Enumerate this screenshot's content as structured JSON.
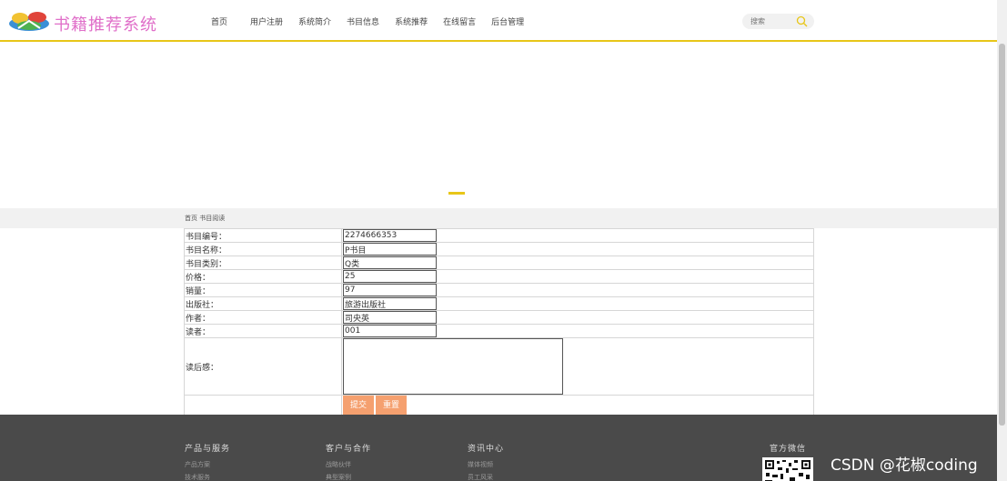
{
  "header": {
    "brand": "书籍推荐系统",
    "nav": [
      "首页",
      "用户注册",
      "系统简介",
      "书目信息",
      "系统推荐",
      "在线留言",
      "后台管理"
    ],
    "search_placeholder": "搜索"
  },
  "breadcrumb": "首页 书目阅读",
  "form": {
    "rows": [
      {
        "label": "书目编号：",
        "value": "2274666353"
      },
      {
        "label": "书目名称：",
        "value": "P书目"
      },
      {
        "label": "书目类别：",
        "value": "Q类"
      },
      {
        "label": "价格：",
        "value": "25"
      },
      {
        "label": "销量：",
        "value": "97"
      },
      {
        "label": "出版社：",
        "value": "旅游出版社"
      },
      {
        "label": "作者：",
        "value": "司央英"
      },
      {
        "label": "读者：",
        "value": "001"
      }
    ],
    "review_label": "读后感：",
    "review_value": "",
    "submit_label": "提交",
    "reset_label": "重置"
  },
  "footer": {
    "col1": {
      "title": "产品与服务",
      "links": [
        "产品方案",
        "技术服务"
      ]
    },
    "col2": {
      "title": "客户与合作",
      "links": [
        "战略伙伴",
        "典型案例"
      ]
    },
    "col3": {
      "title": "资讯中心",
      "links": [
        "媒体视频",
        "员工风采"
      ]
    },
    "wechat_title": "官方微信"
  },
  "watermark": "CSDN @花椒coding",
  "colors": {
    "accent": "#e8c618",
    "brand": "#e06fc9",
    "button": "#f5a06f",
    "footer_bg": "#4a4a4a"
  }
}
